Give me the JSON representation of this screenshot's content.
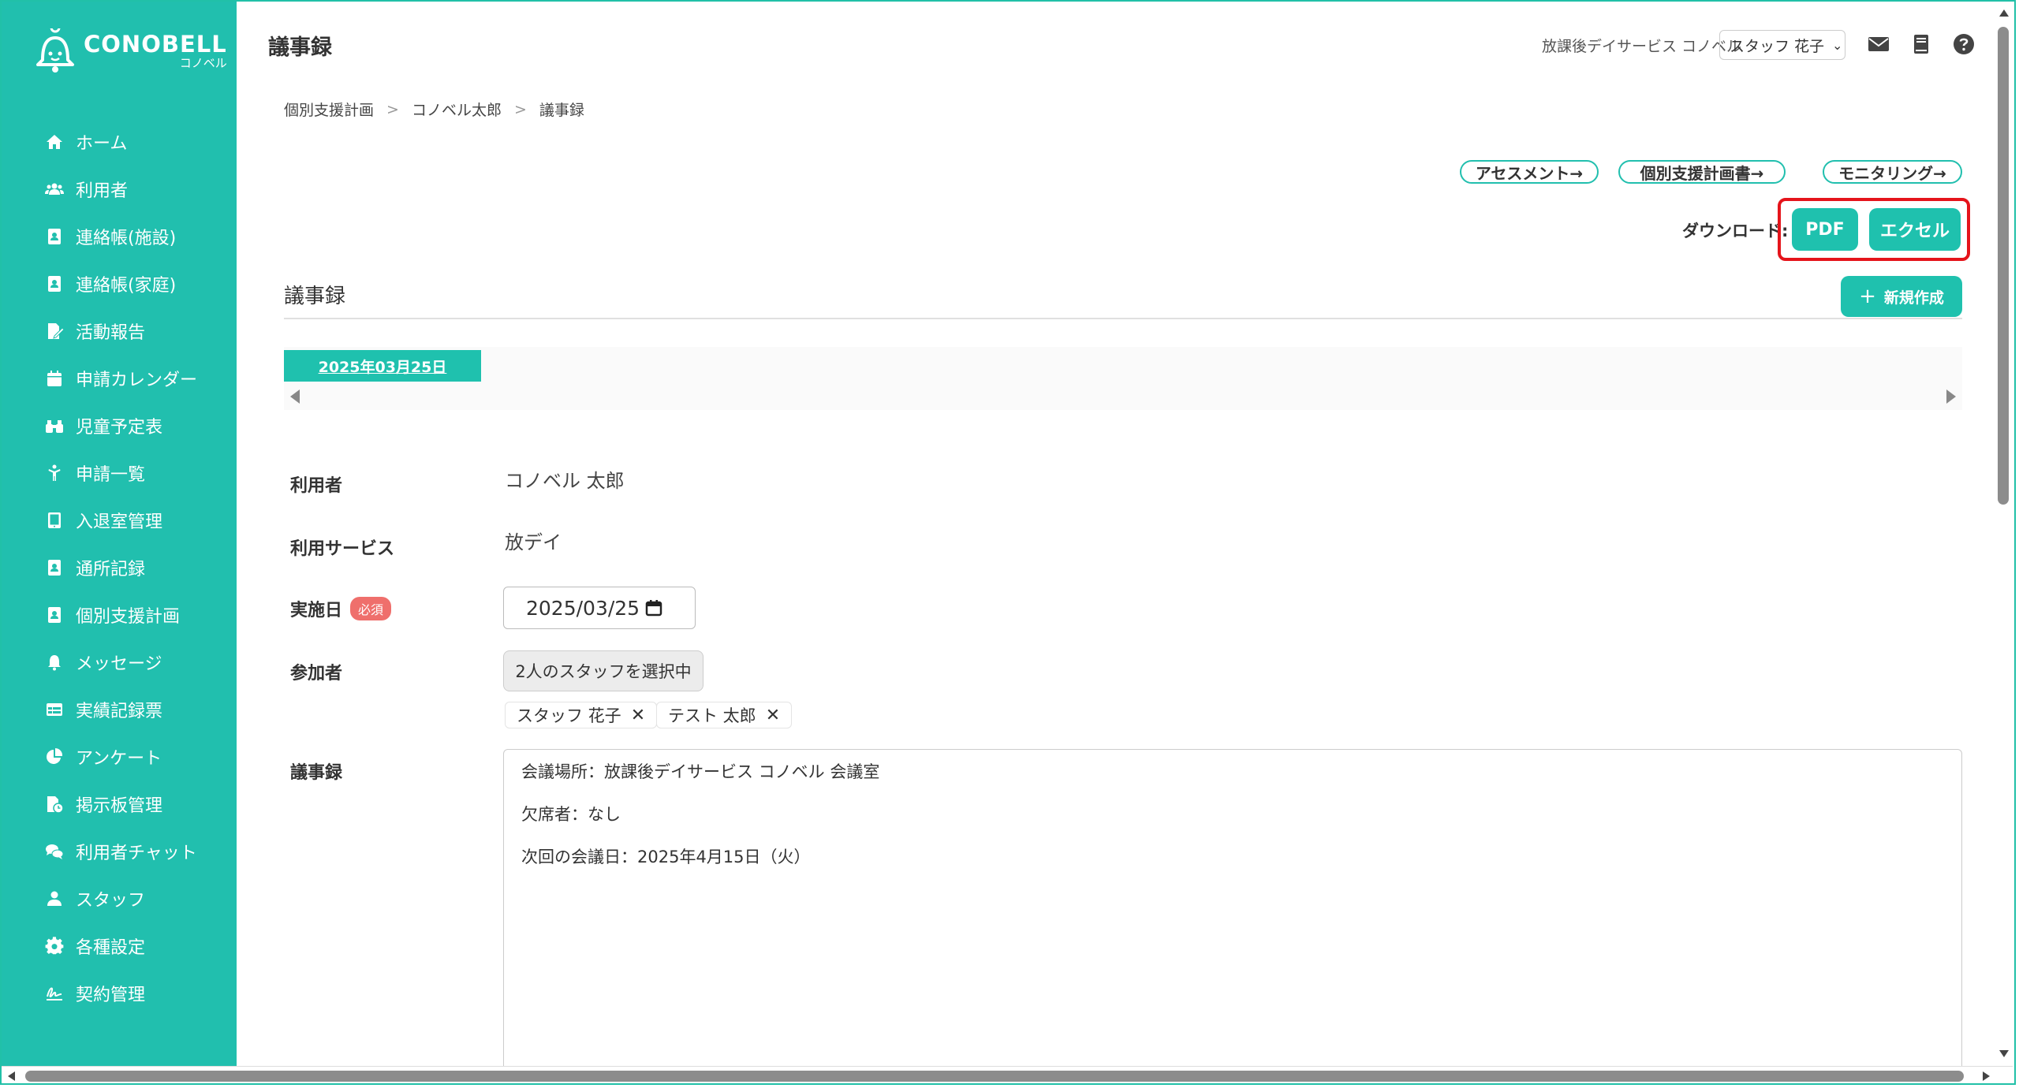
{
  "app": {
    "logo_text": "CONOBELL",
    "logo_sub": "コノベル",
    "page_title": "議事録",
    "facility": "放課後デイサービス コノベル",
    "staff_selector": "スタッフ 花子"
  },
  "sidebar": {
    "items": [
      {
        "label": "ホーム",
        "icon": "home-icon"
      },
      {
        "label": "利用者",
        "icon": "users-icon"
      },
      {
        "label": "連絡帳(施設)",
        "icon": "contact-book-icon"
      },
      {
        "label": "連絡帳(家庭)",
        "icon": "contact-book-icon"
      },
      {
        "label": "活動報告",
        "icon": "edit-document-icon"
      },
      {
        "label": "申請カレンダー",
        "icon": "calendar-icon"
      },
      {
        "label": "児童予定表",
        "icon": "binoculars-icon"
      },
      {
        "label": "申請一覧",
        "icon": "child-icon"
      },
      {
        "label": "入退室管理",
        "icon": "tablet-icon"
      },
      {
        "label": "通所記録",
        "icon": "contact-book-icon"
      },
      {
        "label": "個別支援計画",
        "icon": "contact-book-icon"
      },
      {
        "label": "メッセージ",
        "icon": "bell-icon"
      },
      {
        "label": "実績記録票",
        "icon": "table-icon"
      },
      {
        "label": "アンケート",
        "icon": "pie-chart-icon"
      },
      {
        "label": "掲示板管理",
        "icon": "file-clock-icon"
      },
      {
        "label": "利用者チャット",
        "icon": "chat-icon"
      },
      {
        "label": "スタッフ",
        "icon": "user-icon"
      },
      {
        "label": "各種設定",
        "icon": "gear-icon"
      },
      {
        "label": "契約管理",
        "icon": "signature-icon"
      }
    ]
  },
  "breadcrumb": [
    "個別支援計画",
    "コノベル太郎",
    "議事録"
  ],
  "links": {
    "assessment": "アセスメント→",
    "support_plan": "個別支援計画書→",
    "monitoring": "モニタリング→"
  },
  "download": {
    "label": "ダウンロード:",
    "pdf": "PDF",
    "excel": "エクセル"
  },
  "section": {
    "title": "議事録",
    "new_button": "新規作成"
  },
  "date_tabs": [
    "2025年03月25日"
  ],
  "form": {
    "user_label": "利用者",
    "user_value": "コノベル 太郎",
    "service_label": "利用サービス",
    "service_value": "放デイ",
    "date_label": "実施日",
    "required_badge": "必須",
    "date_value": "2025/03/25",
    "participants_label": "参加者",
    "participants_button": "2人のスタッフを選択中",
    "participants": [
      "スタッフ 花子",
      "テスト 太郎"
    ],
    "minutes_label": "議事録",
    "minutes_lines": [
      "会議場所：放課後デイサービス コノベル 会議室",
      "欠席者：なし",
      "次回の会議日：2025年4月15日（火）"
    ]
  },
  "colors": {
    "brand": "#21bfae",
    "highlight": "#e5141b",
    "required": "#ef6f6c"
  }
}
